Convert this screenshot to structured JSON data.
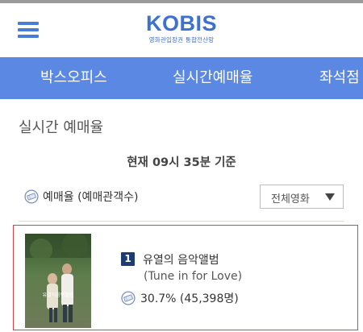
{
  "header": {
    "logo_text": "KOBIS",
    "logo_subtitle": "영화관입장권 통합전산망",
    "menu_icon": "hamburger-menu-icon",
    "brand_color": "#3d70cf"
  },
  "nav": {
    "background": "#5a88e3",
    "items": [
      {
        "label": "박스오피스"
      },
      {
        "label": "실시간예매율"
      },
      {
        "label": "좌석점"
      }
    ]
  },
  "page": {
    "title": "실시간 예매율",
    "as_of": "현재 09시 35분  기준"
  },
  "controls": {
    "rate_label": "예매율 (예매관객수)",
    "rate_icon": "ticket-icon",
    "filter_selected": "전체영화"
  },
  "movies": [
    {
      "rank": "1",
      "title_ko": "유열의 음악앨범",
      "title_en": "(Tune in for Love)",
      "stat": "30.7% (45,398명)",
      "poster_text": "유열의음악앨범",
      "highlight_color": "#d9414b"
    }
  ]
}
